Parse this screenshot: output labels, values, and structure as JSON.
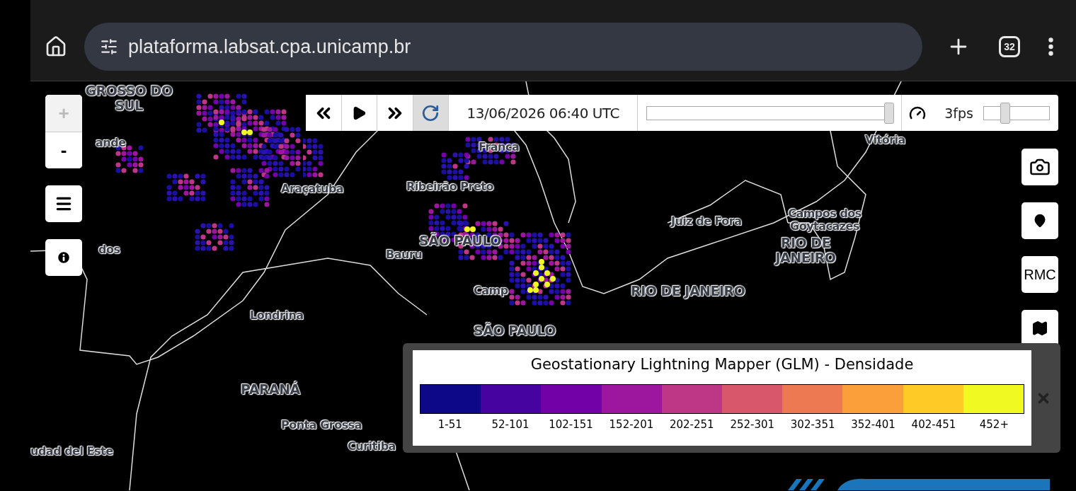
{
  "browser": {
    "url": "plataforma.labsat.cpa.unicamp.br",
    "tab_count": "32"
  },
  "zoom_controls": [
    {
      "label": "+",
      "disabled": true
    },
    {
      "label": "-",
      "disabled": false
    }
  ],
  "player": {
    "date": "13/06/2026 06:40 UTC",
    "refresh_active": true,
    "time_slider": {
      "level": 1.0
    },
    "fps": "3fps",
    "fps_slider": {
      "level": 0.3
    }
  },
  "right_tools": [
    {
      "kind": "camera"
    },
    {
      "kind": "pin"
    },
    {
      "kind": "text",
      "label": "RMC"
    },
    {
      "kind": "map"
    }
  ],
  "map_labels": [
    {
      "text": "GROSSO DO SUL",
      "kind": "state"
    },
    {
      "text": "ande",
      "kind": "city"
    },
    {
      "text": "dos",
      "kind": "city"
    },
    {
      "text": "Araçatuba",
      "kind": "city"
    },
    {
      "text": "Ribeirão Preto",
      "kind": "city"
    },
    {
      "text": "Franca",
      "kind": "city"
    },
    {
      "text": "SÃO PAULO",
      "kind": "state"
    },
    {
      "text": "Bauru",
      "kind": "city"
    },
    {
      "text": "Camp",
      "kind": "city"
    },
    {
      "text": "SÃO PAULO",
      "kind": "state"
    },
    {
      "text": "Londrina",
      "kind": "city"
    },
    {
      "text": "PARANÁ",
      "kind": "state"
    },
    {
      "text": "Ponta Grossa",
      "kind": "city"
    },
    {
      "text": "Curitiba",
      "kind": "city"
    },
    {
      "text": "udad del Este",
      "kind": "city"
    },
    {
      "text": "Juiz de Fora",
      "kind": "city"
    },
    {
      "text": "Campos dos Goytacazes",
      "kind": "city"
    },
    {
      "text": "RIO DE JANEIRO",
      "kind": "state"
    },
    {
      "text": "RIO DE JANEIRO",
      "kind": "state"
    },
    {
      "text": "Vitória",
      "kind": "city"
    }
  ],
  "legend": {
    "title": "Geostationary Lightning Mapper (GLM) - Densidade",
    "bins": [
      {
        "label": "1-51",
        "color": "#0d0887"
      },
      {
        "label": "52-101",
        "color": "#46039f"
      },
      {
        "label": "102-151",
        "color": "#7201a8"
      },
      {
        "label": "152-201",
        "color": "#9c179e"
      },
      {
        "label": "202-251",
        "color": "#bd3786"
      },
      {
        "label": "252-301",
        "color": "#d8576b"
      },
      {
        "label": "302-351",
        "color": "#ed7953"
      },
      {
        "label": "352-401",
        "color": "#fb9f3a"
      },
      {
        "label": "402-451",
        "color": "#fdca26"
      },
      {
        "label": "452+",
        "color": "#f0f921"
      }
    ]
  }
}
